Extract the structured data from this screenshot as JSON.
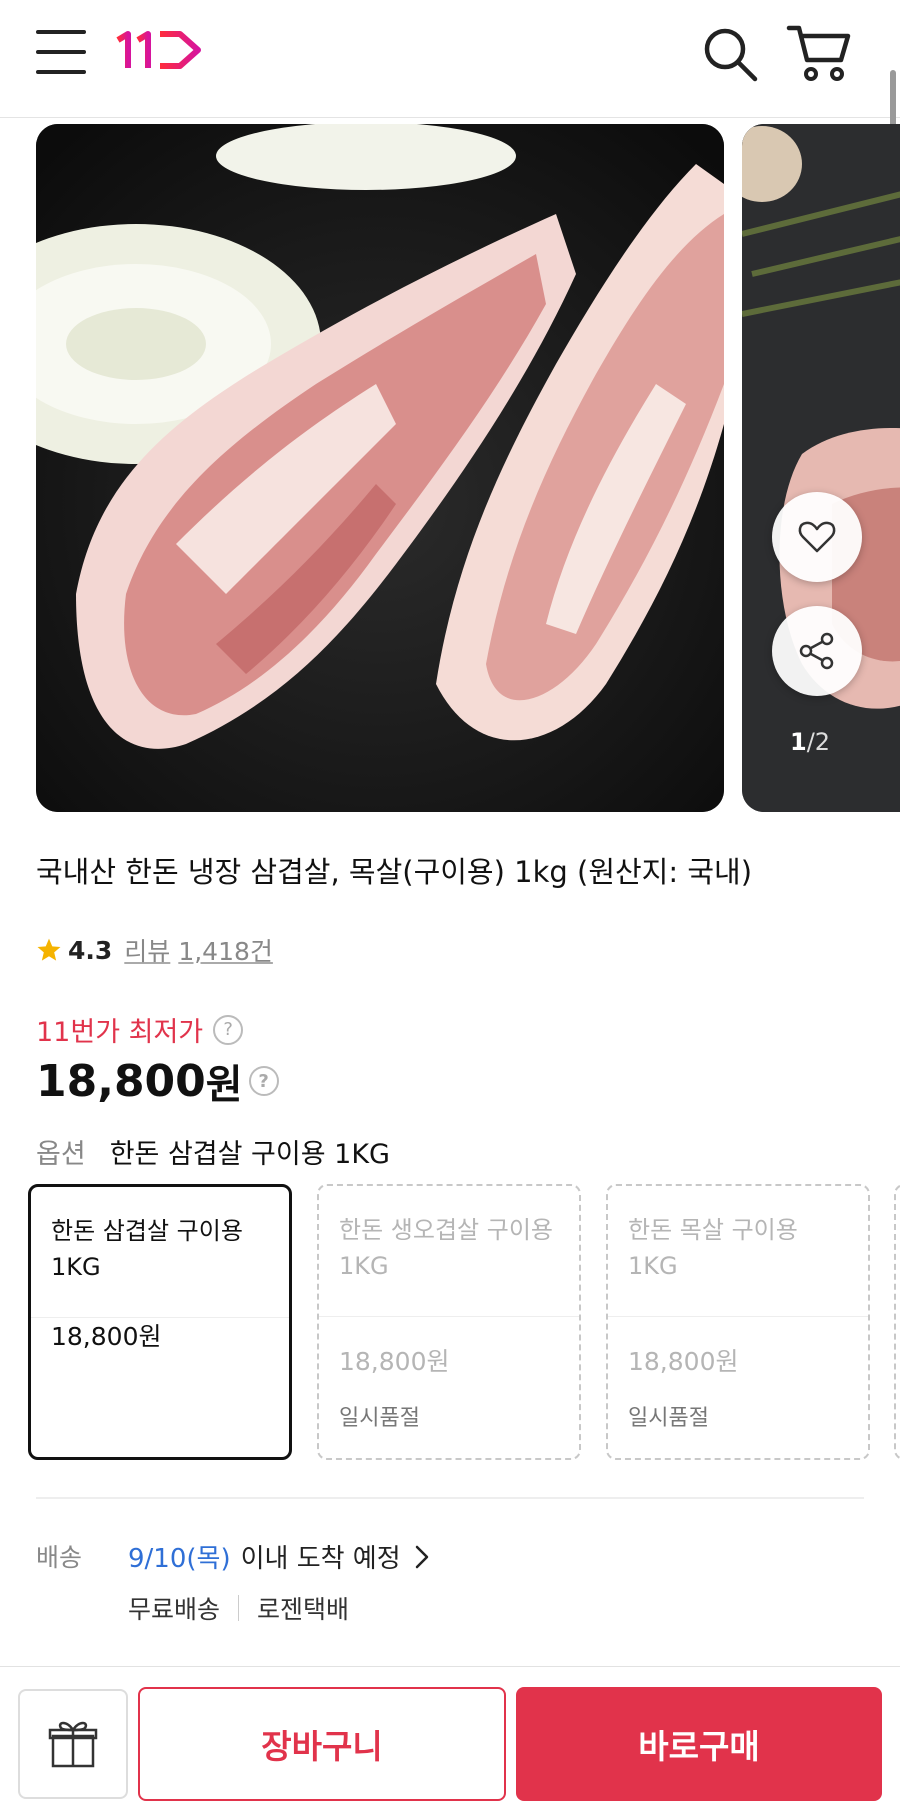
{
  "header": {
    "menu_icon": "hamburger-menu-icon",
    "logo_icon": "11st-logo",
    "search_icon": "search-icon",
    "cart_icon": "cart-icon"
  },
  "gallery": {
    "current_page": "1",
    "separator": "/",
    "total_pages": "2",
    "wish_icon": "heart-icon",
    "share_icon": "share-icon"
  },
  "product": {
    "title": "국내산 한돈 냉장 삼겹살, 목살(구이용) 1kg (원산지: 국내)",
    "rating_value": "4.3",
    "review_label": "리뷰",
    "review_count": "1,418건",
    "lowest_price_label": "11번가 최저가",
    "price_number": "18,800",
    "price_unit": "원",
    "help_icon_label": "?"
  },
  "options": {
    "label": "옵션",
    "selected_name": "한돈 삼겹살 구이용 1KG",
    "items": [
      {
        "name": "한돈 삼겹살 구이용 1KG",
        "price": "18,800원",
        "status": "",
        "selected": true
      },
      {
        "name": "한돈 생오겹살 구이용 1KG",
        "price": "18,800원",
        "status": "일시품절",
        "selected": false
      },
      {
        "name": "한돈 목살 구이용 1KG",
        "price": "18,800원",
        "status": "일시품절",
        "selected": false
      }
    ]
  },
  "shipping": {
    "label": "배송",
    "date": "9/10(목)",
    "arrival_text": "이내 도착 예정",
    "free_shipping": "무료배송",
    "carrier": "로젠택배"
  },
  "bottom_bar": {
    "gift_icon": "gift-icon",
    "cart_button": "장바구니",
    "buy_button": "바로구매"
  },
  "colors": {
    "accent": "#e1334b",
    "date_blue": "#2f6fd6",
    "rating_star": "#f5b300"
  }
}
